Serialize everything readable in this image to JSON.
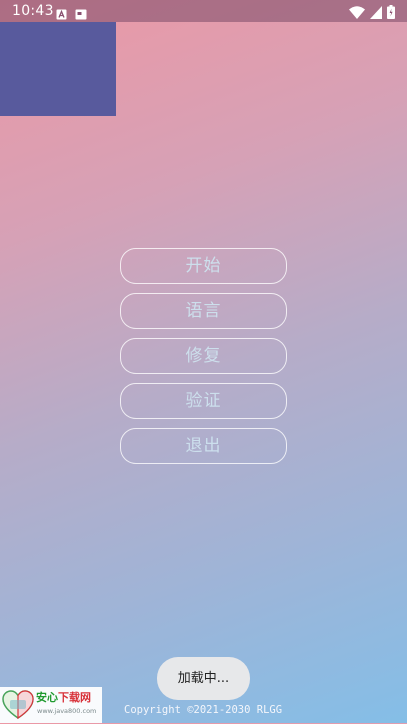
{
  "status_bar": {
    "time": "10:43",
    "left_icons": [
      "a-notification-icon",
      "screen-notification-icon"
    ],
    "right_icons": [
      "wifi-icon",
      "signal-icon",
      "battery-icon"
    ]
  },
  "menu": {
    "items": [
      {
        "label": "开始"
      },
      {
        "label": "语言"
      },
      {
        "label": "修复"
      },
      {
        "label": "验证"
      },
      {
        "label": "退出"
      }
    ]
  },
  "toast": {
    "text": "加载中..."
  },
  "footer": {
    "copyright": "Copyright ©2021-2030 RLGG"
  },
  "watermark": {
    "title_part1": "安心",
    "title_part2": "下载网",
    "url": "www.java800.com"
  },
  "colors": {
    "gradient_top_left": "#ec98a5",
    "gradient_bottom_right": "#84bee7",
    "block": "#585a9d",
    "button_text": "#cde2ee",
    "toast_bg": "#e7e8ea"
  }
}
